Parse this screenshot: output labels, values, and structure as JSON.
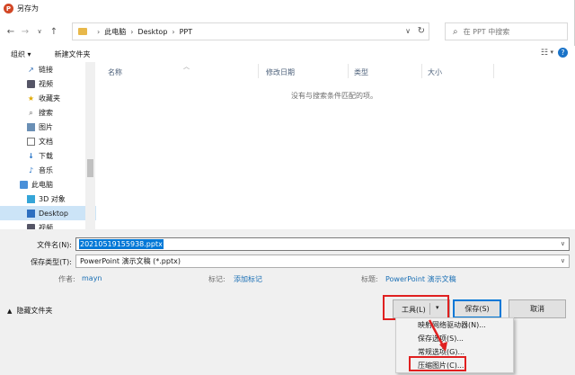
{
  "window": {
    "title": "另存为"
  },
  "nav": {
    "breadcrumb": [
      "此电脑",
      "Desktop",
      "PPT"
    ],
    "search_placeholder": "在 PPT 中搜索"
  },
  "toolbar": {
    "organize": "组织 ▾",
    "new_folder": "新建文件夹"
  },
  "sidebar": {
    "items": [
      {
        "label": "链接",
        "icon": "link-icon"
      },
      {
        "label": "视频",
        "icon": "video-icon"
      },
      {
        "label": "收藏夹",
        "icon": "star-icon"
      },
      {
        "label": "搜索",
        "icon": "search-icon"
      },
      {
        "label": "图片",
        "icon": "image-icon"
      },
      {
        "label": "文档",
        "icon": "document-icon"
      },
      {
        "label": "下载",
        "icon": "download-icon"
      },
      {
        "label": "音乐",
        "icon": "music-icon"
      },
      {
        "label": "此电脑",
        "icon": "computer-icon"
      },
      {
        "label": "3D 对象",
        "icon": "cube-icon"
      },
      {
        "label": "Desktop",
        "icon": "desktop-icon"
      },
      {
        "label": "视频",
        "icon": "video-icon"
      }
    ]
  },
  "columns": {
    "name": "名称",
    "modified": "修改日期",
    "type": "类型",
    "size": "大小"
  },
  "empty_message": "没有与搜索条件匹配的项。",
  "form": {
    "filename_label": "文件名(N):",
    "filename_value": "20210519155938.pptx",
    "filetype_label": "保存类型(T):",
    "filetype_value": "PowerPoint 演示文稿 (*.pptx)",
    "author_label": "作者:",
    "author_value": "mayn",
    "tags_label": "标记:",
    "tags_value": "添加标记",
    "title_label": "标题:",
    "title_value": "PowerPoint 演示文稿"
  },
  "footer": {
    "hide_folders": "隐藏文件夹",
    "tools": "工具(L)",
    "save": "保存(S)",
    "cancel": "取消"
  },
  "tools_menu": {
    "items": [
      "映射网络驱动器(N)...",
      "保存选项(S)...",
      "常规选项(G)...",
      "压缩图片(C)..."
    ]
  },
  "colors": {
    "highlight": "#e02020",
    "accent": "#0078d7"
  }
}
